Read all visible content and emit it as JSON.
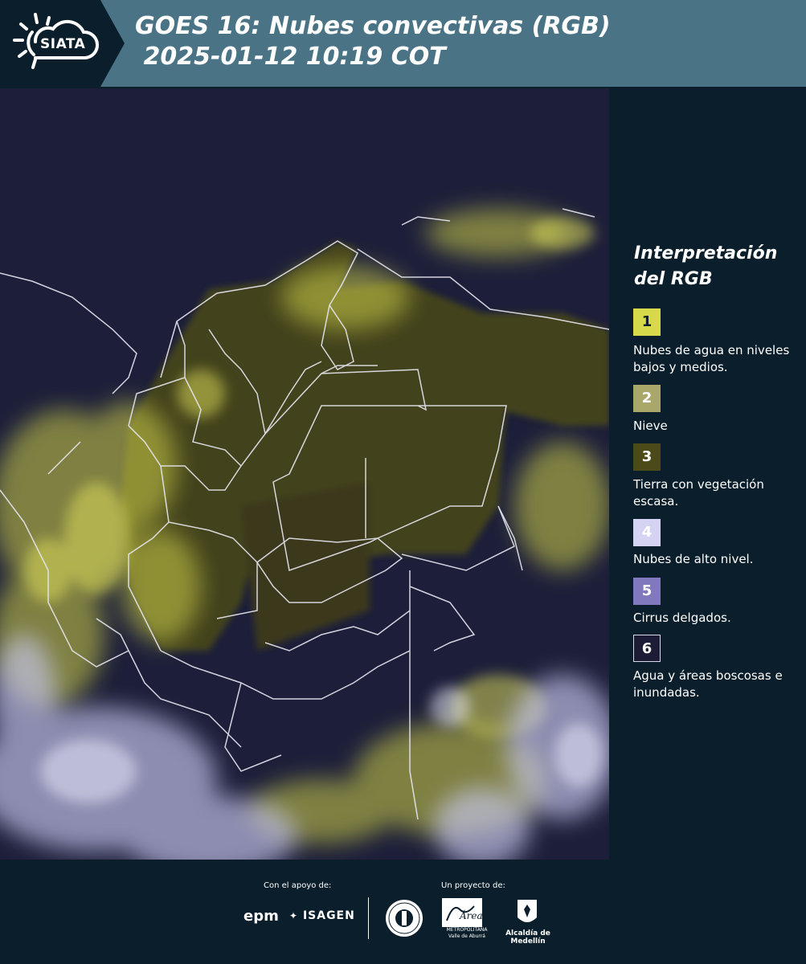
{
  "header": {
    "logo_text": "SIATA",
    "title": "GOES 16: Nubes convectivas (RGB)\n 2025-01-12 10:19 COT"
  },
  "legend": {
    "title": "Interpretación del RGB",
    "items": [
      {
        "number": "1",
        "color": "#d6d94a",
        "text": "Nubes de agua en niveles bajos y medios."
      },
      {
        "number": "2",
        "color": "#a9a86a",
        "text": "Nieve"
      },
      {
        "number": "3",
        "color": "#4d4a19",
        "text": "Tierra con vegetación escasa."
      },
      {
        "number": "4",
        "color": "#d4d3f2",
        "text": "Nubes de alto nivel."
      },
      {
        "number": "5",
        "color": "#8079bd",
        "text": "Cirrus delgados."
      },
      {
        "number": "6",
        "color": "#1d1c36",
        "text": "Agua y áreas boscosas e inundadas."
      }
    ]
  },
  "footer": {
    "support_label": "Con el apoyo de:",
    "project_label": "Un proyecto de:",
    "sponsor_1": "epm",
    "sponsor_2": "ISAGEN",
    "partner_1": "METROPOLITANA Valle de Aburrá",
    "partner_2": "Alcaldía de Medellín"
  },
  "colors": {
    "background": "#0b1e2b",
    "header": "#4a7486",
    "map_base": "#1d1f3a",
    "low_clouds": "#d6d94a",
    "high_clouds": "#d4d3f2"
  }
}
